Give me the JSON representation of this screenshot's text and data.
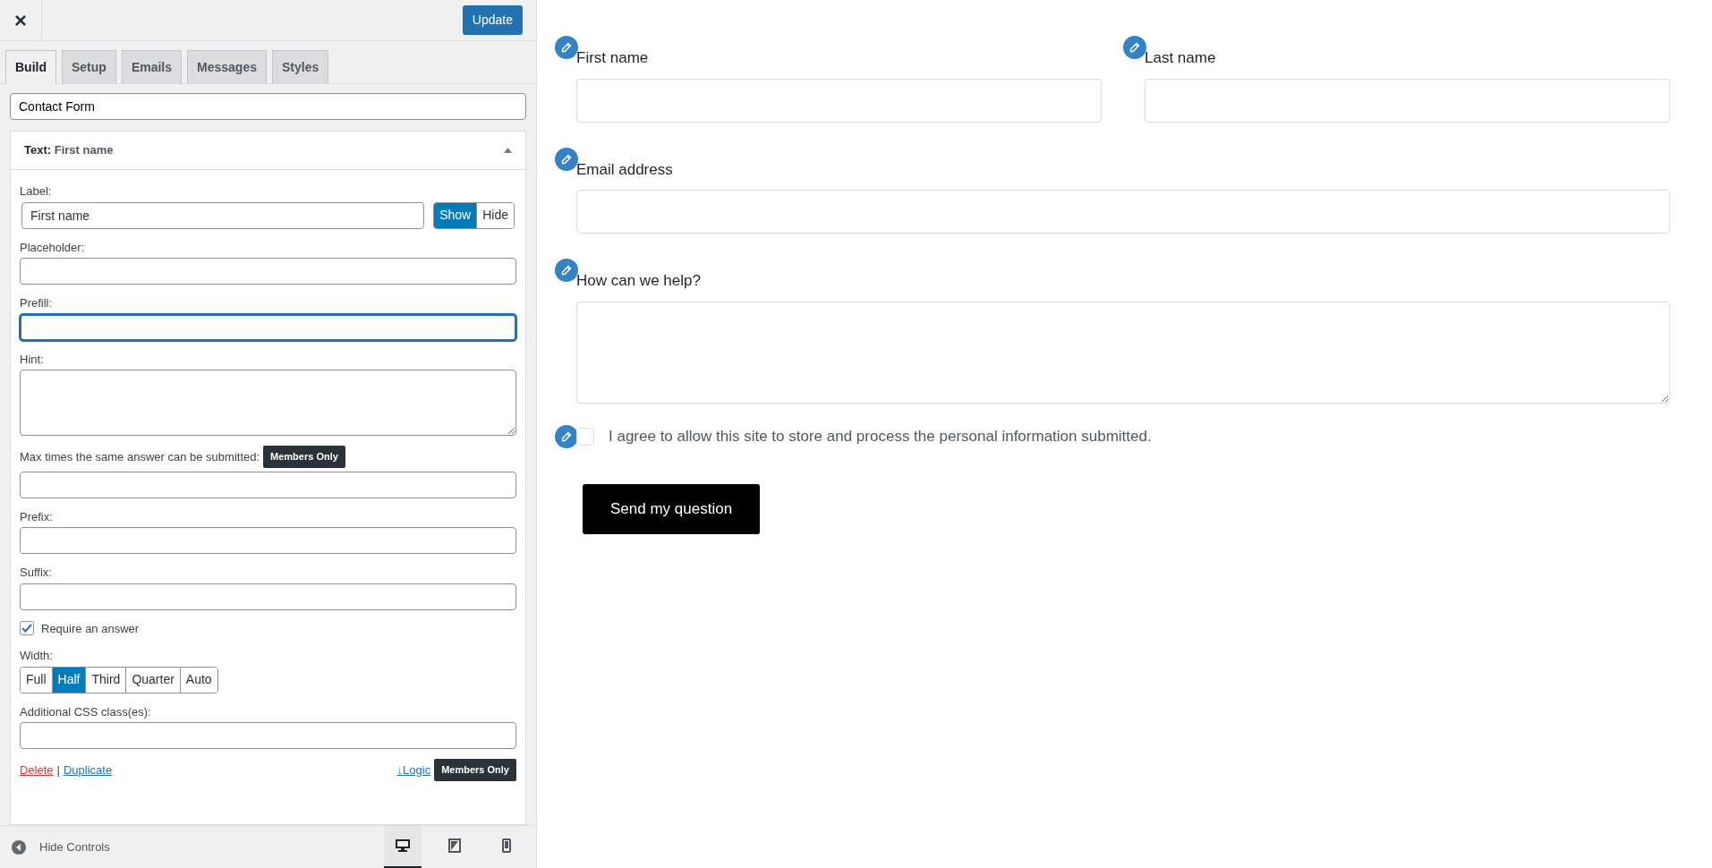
{
  "panel": {
    "close": "×",
    "update": "Update",
    "tabs": [
      {
        "label": "Build",
        "selected": true
      },
      {
        "label": "Setup",
        "selected": false
      },
      {
        "label": "Emails",
        "selected": false
      },
      {
        "label": "Messages",
        "selected": false
      },
      {
        "label": "Styles",
        "selected": false
      }
    ],
    "form_title": "Contact Form",
    "field_editor": {
      "type_label": "Text:",
      "field_name": "First name",
      "expanded": true,
      "label": {
        "caption": "Label:",
        "value": "First name",
        "visibility": [
          {
            "label": "Show",
            "selected": true
          },
          {
            "label": "Hide",
            "selected": false
          }
        ]
      },
      "placeholder": {
        "caption": "Placeholder:"
      },
      "prefill": {
        "caption": "Prefill:",
        "focused": true
      },
      "hint": {
        "caption": "Hint:"
      },
      "max_times": {
        "caption": "Max times the same answer can be submitted:",
        "badge": "Members Only"
      },
      "prefix": {
        "caption": "Prefix:"
      },
      "suffix": {
        "caption": "Suffix:"
      },
      "require": {
        "label": "Require an answer",
        "checked": true
      },
      "width": {
        "caption": "Width:",
        "options": [
          {
            "label": "Full",
            "selected": false
          },
          {
            "label": "Half",
            "selected": true
          },
          {
            "label": "Third",
            "selected": false
          },
          {
            "label": "Quarter",
            "selected": false
          },
          {
            "label": "Auto",
            "selected": false
          }
        ]
      },
      "css_class": {
        "caption": "Additional CSS class(es):"
      },
      "actions": {
        "delete": "Delete",
        "separator": "|",
        "duplicate": "Duplicate",
        "logic": "↓Logic",
        "logic_badge": "Members Only"
      }
    },
    "footer": {
      "hide_controls": "Hide Controls",
      "devices": [
        {
          "kind": "desktop",
          "selected": true
        },
        {
          "kind": "tablet",
          "selected": false
        },
        {
          "kind": "mobile",
          "selected": false
        }
      ]
    }
  },
  "preview": {
    "rows": [
      [
        {
          "kind": "text",
          "label": "First name"
        },
        {
          "kind": "text",
          "label": "Last name"
        }
      ],
      [
        {
          "kind": "text",
          "label": "Email address"
        }
      ],
      [
        {
          "kind": "textarea",
          "label": "How can we help?"
        }
      ],
      [
        {
          "kind": "checkbox",
          "label": "I agree to allow this site to store and process the personal information submitted.",
          "checked": false
        }
      ]
    ],
    "submit": "Send my question"
  }
}
